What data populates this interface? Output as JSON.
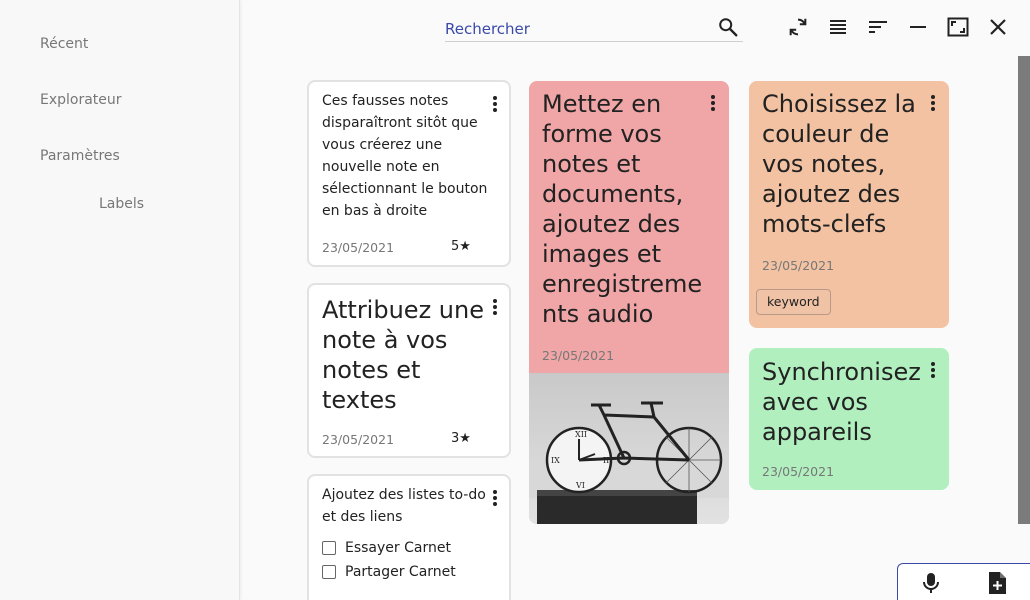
{
  "sidebar": {
    "items": [
      {
        "label": "Récent"
      },
      {
        "label": "Explorateur"
      },
      {
        "label": "Paramètres"
      },
      {
        "label": "Labels"
      }
    ]
  },
  "search": {
    "placeholder": "Rechercher"
  },
  "toolbar": {
    "icons": [
      "search-icon",
      "sync-icon",
      "list-view-icon",
      "sort-icon",
      "minimize-icon",
      "maximize-icon",
      "close-icon"
    ]
  },
  "notes": {
    "n1": {
      "text_lines": [
        "Ces fausses notes",
        "disparaîtront sitôt que",
        "vous créerez une",
        "nouvelle note en",
        "sélectionnant le bouton",
        "en bas à droite"
      ],
      "date": "23/05/2021",
      "rating": "5★"
    },
    "n2": {
      "title_lines": [
        "Attribuez une",
        "note à vos",
        "notes et",
        "textes"
      ],
      "date": "23/05/2021",
      "rating": "3★"
    },
    "n3": {
      "text_lines": [
        "Ajoutez des listes to-do",
        "et des liens"
      ],
      "todos": [
        "Essayer Carnet",
        "Partager Carnet"
      ]
    },
    "n4": {
      "title_lines": [
        "Mettez en",
        "forme vos",
        "notes et",
        "documents,",
        "ajoutez des",
        "images et",
        "enregistreme",
        "nts audio"
      ],
      "date": "23/05/2021",
      "color": "#f0a6a6",
      "image": "bicycle-clock-photo"
    },
    "n5": {
      "title_lines": [
        "Choisissez la",
        "couleur de",
        "vos notes,",
        "ajoutez des",
        "mots-clefs"
      ],
      "date": "23/05/2021",
      "keyword": "keyword",
      "color": "#f2c2a2"
    },
    "n6": {
      "title_lines": [
        "Synchronisez",
        "avec vos",
        "appareils"
      ],
      "date": "23/05/2021",
      "color": "#b1efbf"
    }
  },
  "fab": {
    "icons": [
      "microphone-icon",
      "new-note-icon"
    ]
  },
  "colors": {
    "accent": "#3a4aa8"
  }
}
